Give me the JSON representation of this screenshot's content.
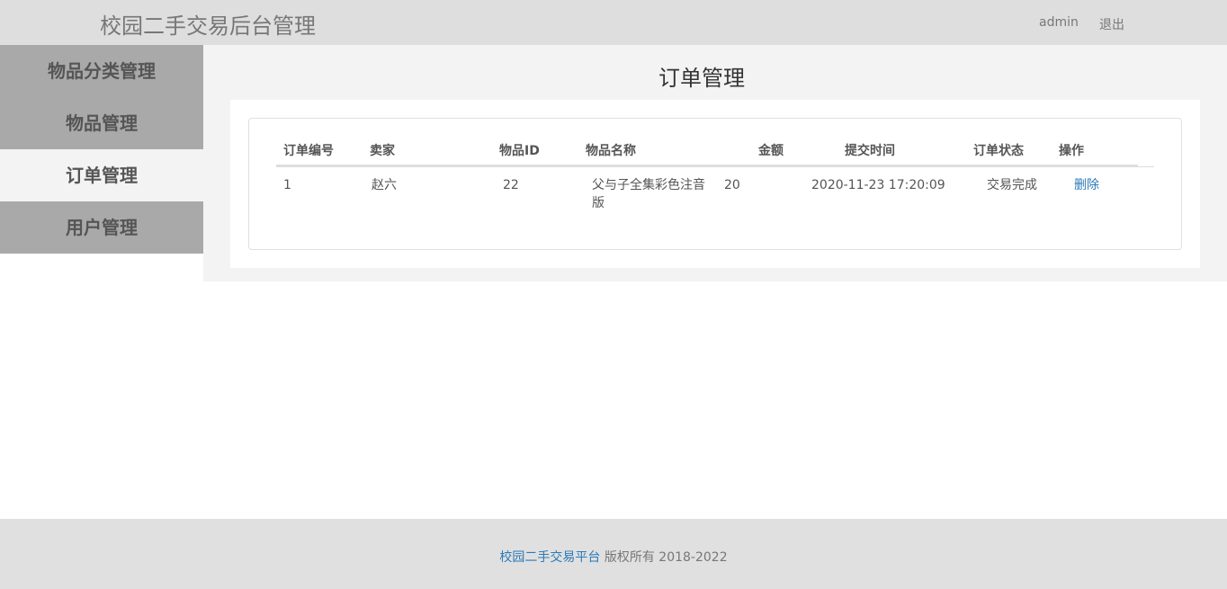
{
  "header": {
    "brand": "校园二手交易后台管理",
    "user": "admin",
    "logout": "退出"
  },
  "sidebar": {
    "items": [
      {
        "label": "物品分类管理"
      },
      {
        "label": "物品管理"
      },
      {
        "label": "订单管理"
      },
      {
        "label": "用户管理"
      }
    ],
    "active_index": 2
  },
  "main": {
    "title": "订单管理",
    "table": {
      "headers": [
        "订单编号",
        "卖家",
        "物品ID",
        "物品名称",
        "金额",
        "提交时间",
        "订单状态",
        "操作"
      ],
      "rows": [
        {
          "order_id": "1",
          "seller": "赵六",
          "item_id": "22",
          "item_name": "父与子全集彩色注音版",
          "amount": "20",
          "submit_time": "2020-11-23 17:20:09",
          "status": "交易完成",
          "action": "删除"
        }
      ]
    }
  },
  "footer": {
    "link": "校园二手交易平台",
    "text": " 版权所有  2018-2022"
  },
  "colors": {
    "header_bg": "#dedede",
    "sidebar_bg": "#a9a9a9",
    "active_bg": "#f3f3f3",
    "link": "#2a7ab8"
  }
}
